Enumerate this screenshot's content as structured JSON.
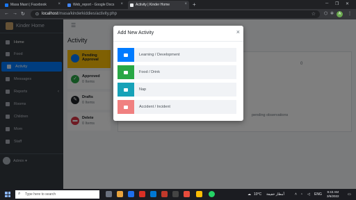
{
  "browser": {
    "tabs": [
      {
        "title": "Masa Masri | Facebook",
        "favicon_color": "#1877f2"
      },
      {
        "title": "Web_report - Google Docs",
        "favicon_color": "#4285f4"
      },
      {
        "title": "Activity | Kinder Home",
        "favicon_color": "#e8eaed"
      }
    ],
    "new_tab": "+",
    "url_host": "localhost",
    "url_path": "/masa/kinderkiddies/activity.php",
    "profile_initial": "A"
  },
  "sidebar": {
    "brand": "Kinder Home",
    "items": [
      {
        "label": "Home"
      },
      {
        "label": "Food"
      },
      {
        "label": "Activity"
      },
      {
        "label": "Messages"
      },
      {
        "label": "Reports",
        "chevron": "‹"
      },
      {
        "label": "Rooms"
      },
      {
        "label": "Children"
      },
      {
        "label": "Mom"
      },
      {
        "label": "Staff"
      }
    ],
    "user": "Admin ▾"
  },
  "main": {
    "hamburger": "☰",
    "title": "Activity",
    "categories": [
      {
        "title": "Pending Approval",
        "sub": "",
        "color": "#007bff",
        "icon": "clipboard-icon",
        "glyph": ""
      },
      {
        "title": "Approved",
        "sub": "0 Items",
        "color": "#28a745",
        "icon": "check-icon",
        "glyph": "✓"
      },
      {
        "title": "Drafts",
        "sub": "0 Items",
        "color": "#212529",
        "icon": "pencil-icon",
        "glyph": "✎"
      },
      {
        "title": "Delete",
        "sub": "0 Items",
        "color": "#dc3545",
        "icon": "trash-icon",
        "glyph": "▬"
      }
    ],
    "panel_counter": "0",
    "panel_note": "pending observations"
  },
  "modal": {
    "title": "Add New Activity",
    "close": "×",
    "options": [
      {
        "label": "Learning / Development",
        "color": "#007bff",
        "icon": "book-icon"
      },
      {
        "label": "Food / Drink",
        "color": "#28a745",
        "icon": "utensils-icon"
      },
      {
        "label": "Nap",
        "color": "#17a2b8",
        "icon": "bed-icon"
      },
      {
        "label": "Accident / Incident",
        "color": "#f08080",
        "icon": "bandage-icon"
      }
    ]
  },
  "taskbar": {
    "search_placeholder": "Type here to search",
    "weather": "10°C",
    "weather_desc": "أمطار خفيفة",
    "lang": "ENG",
    "time": "9:43 AM",
    "date": "3/6/2022"
  }
}
